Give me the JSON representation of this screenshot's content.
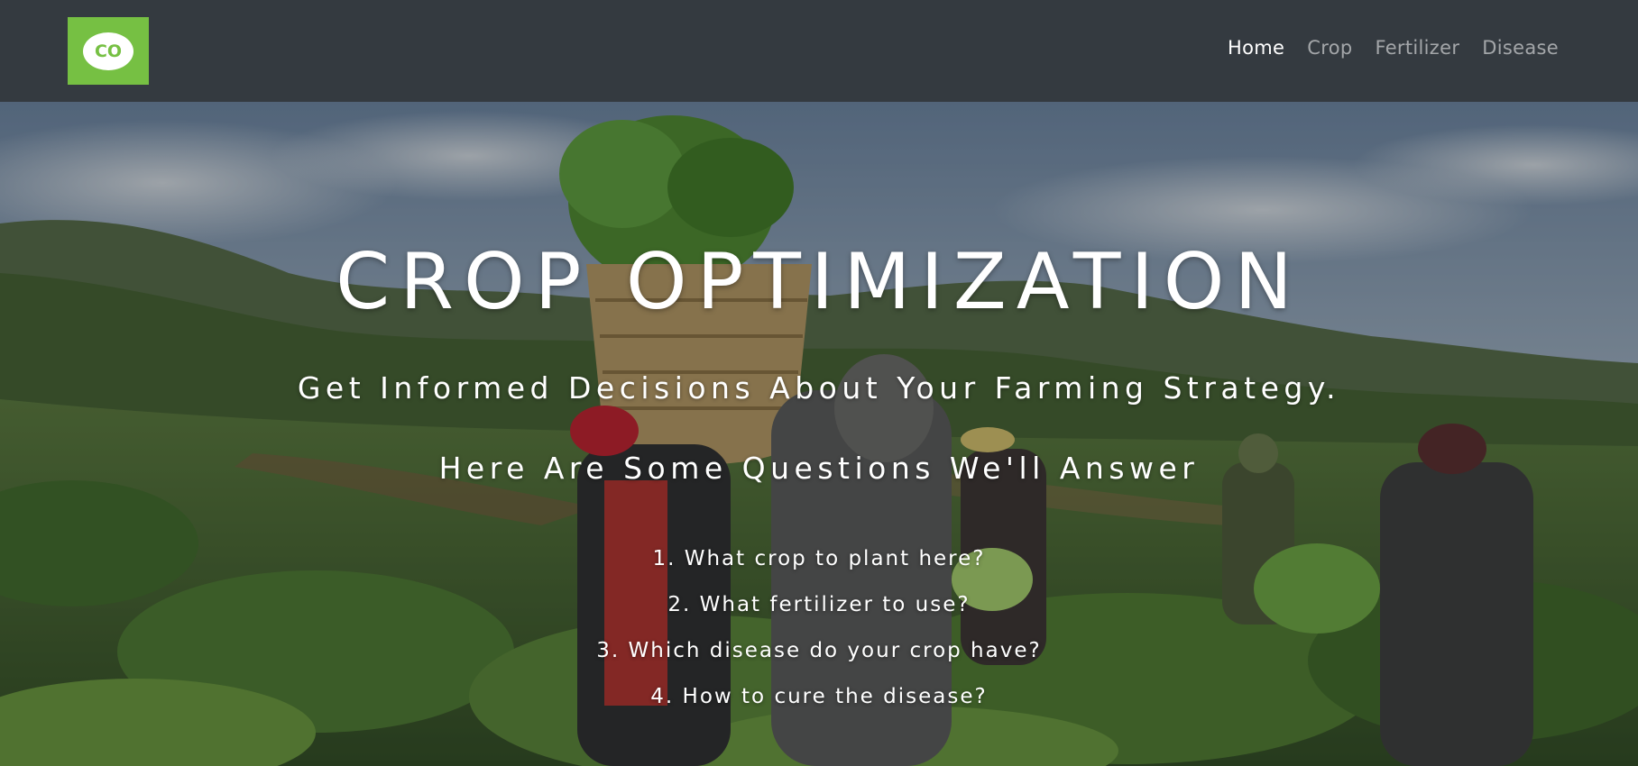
{
  "brand": {
    "logo_text": "CO",
    "accent_color": "#76c043"
  },
  "nav": {
    "background": "#343a40",
    "links": [
      {
        "label": "Home",
        "active": true
      },
      {
        "label": "Crop",
        "active": false
      },
      {
        "label": "Fertilizer",
        "active": false
      },
      {
        "label": "Disease",
        "active": false
      }
    ]
  },
  "hero": {
    "title": "CROP OPTIMIZATION",
    "subtitle": "Get Informed Decisions About Your Farming Strategy.",
    "questions_heading": "Here Are Some Questions We'll Answer",
    "questions": [
      "1. What crop to plant here?",
      "2. What fertilizer to use?",
      "3. Which disease do your crop have?",
      "4. How to cure the disease?"
    ]
  }
}
